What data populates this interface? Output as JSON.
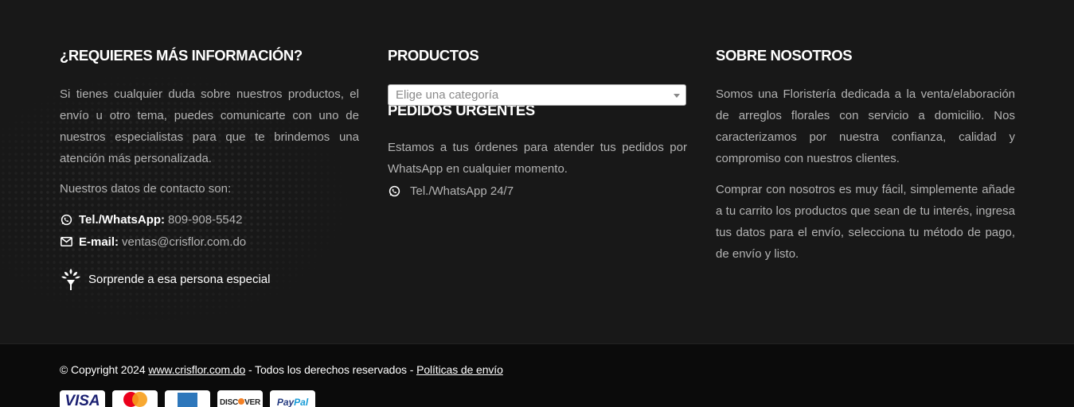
{
  "col_info": {
    "title": "¿REQUIERES MÁS INFORMACIÓN?",
    "text": "Si tienes cualquier duda sobre nuestros productos, el envío u otro tema, puedes comunicarte con uno de nuestros especialistas para que te brindemos una atención más personalizada.",
    "contact_intro": "Nuestros datos de contacto son:",
    "phone_label": "Tel./WhatsApp:",
    "phone_value": "809-908-5542",
    "email_label": "E-mail:",
    "email_value": "ventas@crisflor.com.do",
    "promo": "Sorprende a esa persona especial"
  },
  "col_products": {
    "title": "PRODUCTOS",
    "select_placeholder": "Elige una categoría",
    "urgent_title": "PEDIDOS URGENTES",
    "urgent_text": "Estamos a tus órdenes para atender tus pedidos por WhatsApp en cualquier momento.",
    "urgent_contact": "Tel./WhatsApp 24/7"
  },
  "col_about": {
    "title": "SOBRE NOSOTROS",
    "p1": "Somos una Floristería dedicada a la venta/elaboración de arreglos florales con servicio a domicilio. Nos caracterizamos por nuestra confianza, calidad y compromiso con nuestros clientes.",
    "p2": "Comprar con nosotros es muy fácil, simplemente añade a tu carrito los productos que sean de tu interés, ingresa tus datos para el envío, selecciona tu método de pago, de envío y listo."
  },
  "bottom": {
    "copyright_prefix": "© Copyright 2024",
    "site_link": "www.crisflor.com.do",
    "rights": "- Todos los derechos reservados -",
    "shipping_link": "Políticas de envío",
    "cards": {
      "visa": "VISA",
      "discover_a": "DISC",
      "discover_b": "VER",
      "paypal_a": "Pay",
      "paypal_b": "Pal"
    }
  },
  "colors": {
    "background": "#181818",
    "bottom_background": "#0b0b0b",
    "heading": "#ffffff",
    "text": "#b3b3b3"
  },
  "icons": [
    "whatsapp-icon",
    "envelope-icon",
    "flower-bouquet-icon",
    "chevron-down-icon"
  ]
}
